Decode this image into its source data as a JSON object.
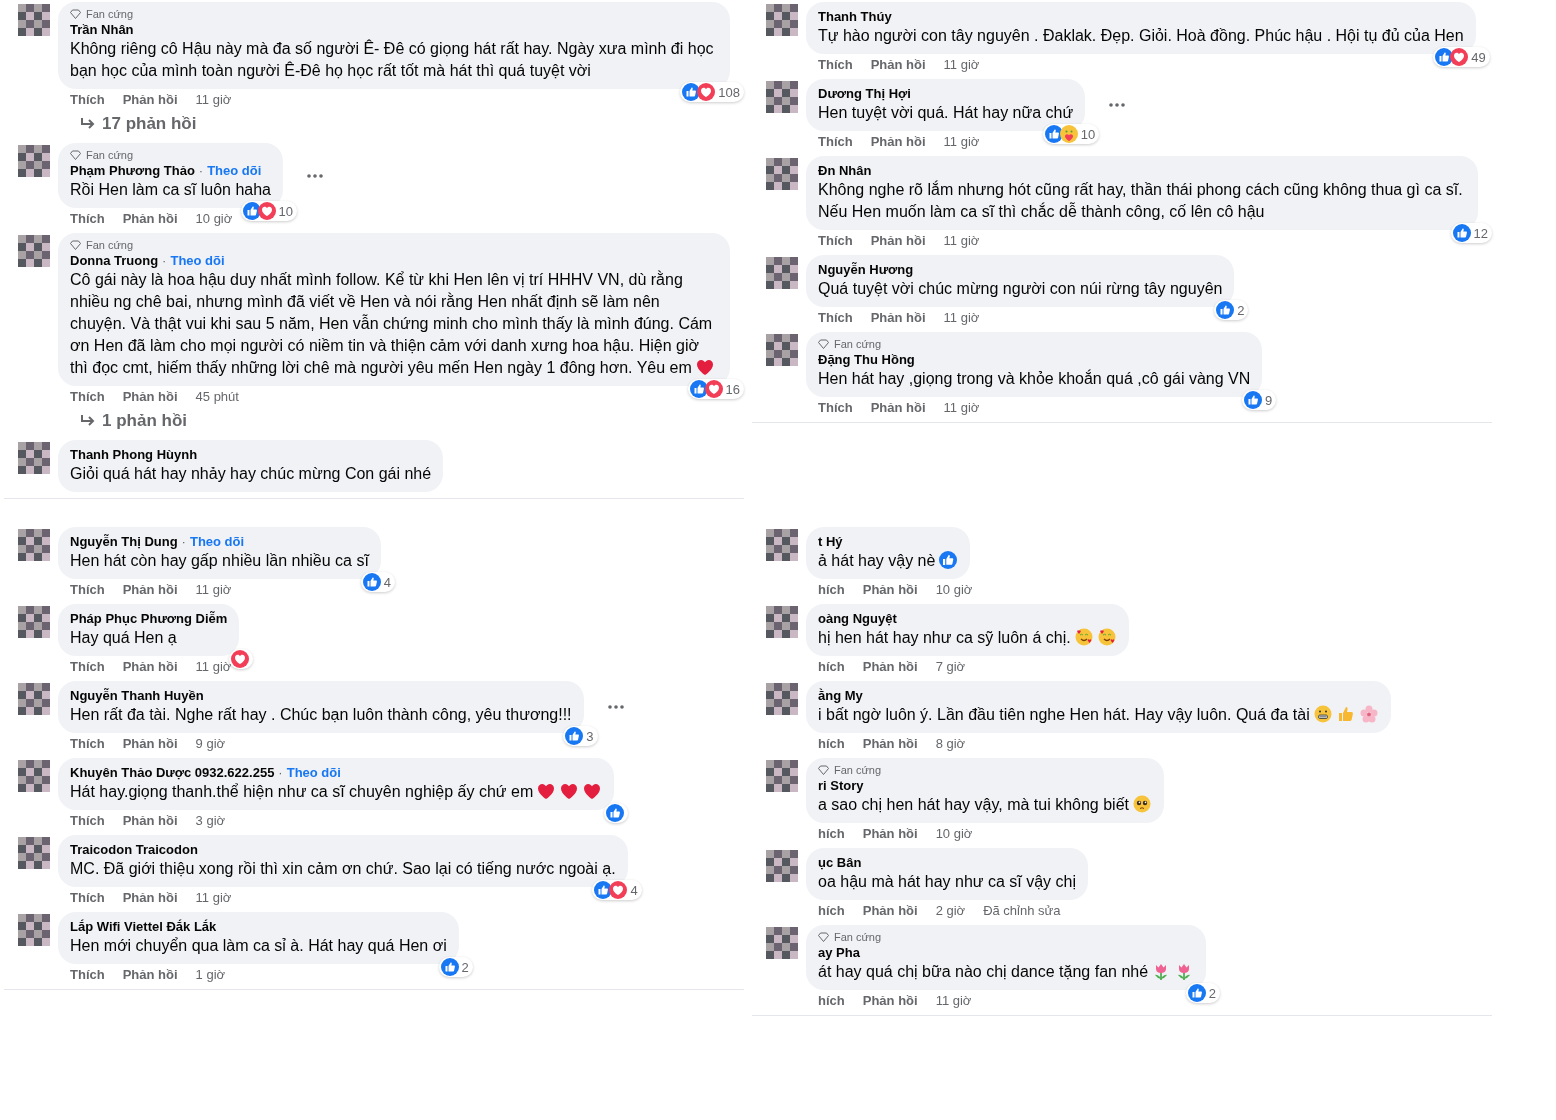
{
  "panels": [
    {
      "items": [
        {
          "kind": "comment",
          "badge": "Fan cứng",
          "name": "Trần Nhân",
          "text": "Không riêng cô Hậu này mà đa số người Ê- Đê có giọng hát rất hay. Ngày xưa mình đi học bạn học của mình toàn người Ê-Đê họ học rất tốt mà hát thì quá tuyệt vời",
          "reactions": [
            {
              "kind": "like"
            },
            {
              "kind": "love"
            }
          ],
          "count": "108",
          "actions": [
            "Thích",
            "Phản hồi",
            "11 giờ"
          ]
        },
        {
          "kind": "replies",
          "label": "17 phản hồi"
        },
        {
          "kind": "comment",
          "badge": "Fan cứng",
          "name": "Phạm Phương Thảo",
          "separator": "·",
          "follow": "Theo dõi",
          "text": "Rồi Hen làm ca sĩ luôn haha",
          "reactions": [
            {
              "kind": "like"
            },
            {
              "kind": "love"
            }
          ],
          "count": "10",
          "more": true,
          "actions": [
            "Thích",
            "Phản hồi",
            "10 giờ"
          ]
        },
        {
          "kind": "comment",
          "badge": "Fan cứng",
          "name": "Donna Truong",
          "separator": "·",
          "follow": "Theo dõi",
          "text": "Cô gái này là hoa hậu duy nhất mình follow. Kể từ khi Hen lên vị trí HHHV VN, dù rằng nhiều ng chê bai, nhưng mình đã viết về Hen và nói rằng Hen nhất định sẽ làm nên chuyện. Và thật vui khi sau 5 năm, Hen vẫn chứng minh cho mình thấy là mình đúng. Cám ơn Hen đã làm cho mọi người có niềm tin và thiện cảm với danh xưng hoa hậu. Hiện giờ thì đọc cmt, hiếm thấy những lời chê mà người yêu mến Hen ngày 1 đông hơn. Yêu em",
          "emojis": [
            {
              "kind": "heart"
            }
          ],
          "reactions": [
            {
              "kind": "like"
            },
            {
              "kind": "love"
            }
          ],
          "count": "16",
          "actions": [
            "Thích",
            "Phản hồi",
            "45 phút"
          ]
        },
        {
          "kind": "replies",
          "label": "1 phản hồi"
        },
        {
          "kind": "comment",
          "name": "Thanh Phong Hùynh",
          "text": "Giỏi quá hát hay nhảy hay chúc mừng Con gái nhé"
        }
      ]
    },
    {
      "items": [
        {
          "kind": "comment",
          "name": "Thanh Thúy",
          "text": "Tự hào người con tây nguyên . Đaklak. Đẹp. Giỏi. Hoà đồng. Phúc hậu . Hội tụ đủ của Hen",
          "reactions": [
            {
              "kind": "like"
            },
            {
              "kind": "love"
            }
          ],
          "count": "49",
          "actions": [
            "Thích",
            "Phản hồi",
            "11 giờ"
          ]
        },
        {
          "kind": "comment",
          "name": "Dương Thị Hợi",
          "text": "Hen tuyệt vời quá. Hát hay nữa chứ",
          "reactions": [
            {
              "kind": "like"
            },
            {
              "kind": "care"
            }
          ],
          "count": "10",
          "more": true,
          "actions": [
            "Thích",
            "Phản hồi",
            "11 giờ"
          ]
        },
        {
          "kind": "comment",
          "name": "Đn Nhân",
          "text": "Không nghe rõ lắm nhưng hót cũng rất hay, thần thái phong cách cũng không thua gì ca sĩ. Nếu Hen muốn làm ca sĩ thì chắc dễ thành công, cố lên cô hậu",
          "reactions": [
            {
              "kind": "like"
            }
          ],
          "count": "12",
          "actions": [
            "Thích",
            "Phản hồi",
            "11 giờ"
          ]
        },
        {
          "kind": "comment",
          "name": "Nguyễn Hương",
          "text": "Quá tuyệt vời chúc mừng người con núi rừng tây nguyên",
          "reactions": [
            {
              "kind": "like"
            }
          ],
          "count": "2",
          "actions": [
            "Thích",
            "Phản hồi",
            "11 giờ"
          ]
        },
        {
          "kind": "comment",
          "badge": "Fan cứng",
          "name": "Đặng Thu Hồng",
          "text": "Hen hát hay ,giọng trong và khỏe khoắn quá ,cô gái vàng VN",
          "reactions": [
            {
              "kind": "like"
            }
          ],
          "count": "9",
          "actions": [
            "Thích",
            "Phản hồi",
            "11 giờ"
          ]
        }
      ]
    },
    {
      "items": [
        {
          "kind": "comment",
          "name": "Nguyễn Thị Dung",
          "separator": "·",
          "follow": "Theo dõi",
          "text": "Hen hát còn hay gấp nhiều lần nhiều ca sĩ",
          "reactions": [
            {
              "kind": "like"
            }
          ],
          "count": "4",
          "actions": [
            "Thích",
            "Phản hồi",
            "11 giờ"
          ]
        },
        {
          "kind": "comment",
          "name": "Pháp Phục Phương Diễm",
          "text": "Hay quá Hen ạ",
          "reactions": [
            {
              "kind": "love"
            }
          ],
          "actions": [
            "Thích",
            "Phản hồi",
            "11 giờ"
          ]
        },
        {
          "kind": "comment",
          "name": "Nguyễn Thanh Huyền",
          "text": "Hen rất đa tài. Nghe rất hay . Chúc bạn luôn thành công, yêu thương!!!",
          "reactions": [
            {
              "kind": "like"
            }
          ],
          "count": "3",
          "more": true,
          "actions": [
            "Thích",
            "Phản hồi",
            "9 giờ"
          ]
        },
        {
          "kind": "comment",
          "name": "Khuyên Thảo Dược 0932.622.255",
          "separator": "·",
          "follow": "Theo dõi",
          "text": "Hát hay.giọng thanh.thể hiện như ca sĩ chuyên nghiệp ấy chứ em",
          "emojis": [
            {
              "kind": "heart"
            },
            {
              "kind": "heart"
            },
            {
              "kind": "heart"
            }
          ],
          "reactions": [
            {
              "kind": "like"
            }
          ],
          "actions": [
            "Thích",
            "Phản hồi",
            "3 giờ"
          ]
        },
        {
          "kind": "comment",
          "name": "Traicodon Traicodon",
          "text": "MC. Đã giới thiệu xong rồi thì xin cảm ơn chứ. Sao lại có tiếng nước ngoài ạ.",
          "reactions": [
            {
              "kind": "like"
            },
            {
              "kind": "love"
            }
          ],
          "count": "4",
          "actions": [
            "Thích",
            "Phản hồi",
            "11 giờ"
          ]
        },
        {
          "kind": "comment",
          "name": "Lắp Wifi Viettel Đắk Lắk",
          "text": "Hen mới chuyển qua làm ca sỉ à. Hát hay quá Hen ơi",
          "reactions": [
            {
              "kind": "like"
            }
          ],
          "count": "2",
          "actions": [
            "Thích",
            "Phản hồi",
            "1 giờ"
          ]
        }
      ]
    },
    {
      "items": [
        {
          "kind": "comment",
          "name": "t Hý",
          "text": "ả hát hay vậy nè",
          "emojis": [
            {
              "kind": "like"
            }
          ],
          "actions": [
            "hích",
            "Phản hồi",
            "10 giờ"
          ]
        },
        {
          "kind": "comment",
          "name": "oàng Nguyệt",
          "text": "hị hen hát hay như ca sỹ luôn á chị.",
          "emojis": [
            {
              "kind": "hearts-face"
            },
            {
              "kind": "hearts-face"
            }
          ],
          "actions": [
            "hích",
            "Phản hồi",
            "7 giờ"
          ]
        },
        {
          "kind": "comment",
          "name": "ằng My",
          "text": "i bất ngờ luôn ý. Lần đầu tiên nghe Hen hát. Hay vậy luôn. Quá đa tài",
          "emojis": [
            {
              "kind": "grimace"
            },
            {
              "kind": "thumb"
            },
            {
              "kind": "flower"
            }
          ],
          "actions": [
            "hích",
            "Phản hồi",
            "8 giờ"
          ]
        },
        {
          "kind": "comment",
          "badge": "Fan cứng",
          "name": "ri Story",
          "text": "a sao chị hen hát hay vậy, mà tui không biết",
          "emojis": [
            {
              "kind": "pleading"
            }
          ],
          "actions": [
            "hích",
            "Phản hồi",
            "10 giờ"
          ]
        },
        {
          "kind": "comment",
          "name": "ục Bân",
          "text": "oa hậu mà hát hay như ca sĩ vậy chị",
          "actions": [
            "hích",
            "Phản hồi",
            "2 giờ",
            "Đã chỉnh sửa"
          ]
        },
        {
          "kind": "comment",
          "badge": "Fan cứng",
          "name": "ay Pha",
          "text": "át hay quá chị bữa nào chị dance tặng fan nhé",
          "emojis": [
            {
              "kind": "tulip"
            },
            {
              "kind": "tulip"
            }
          ],
          "reactions": [
            {
              "kind": "like"
            }
          ],
          "count": "2",
          "actions": [
            "hích",
            "Phản hồi",
            "11 giờ"
          ]
        }
      ]
    }
  ]
}
